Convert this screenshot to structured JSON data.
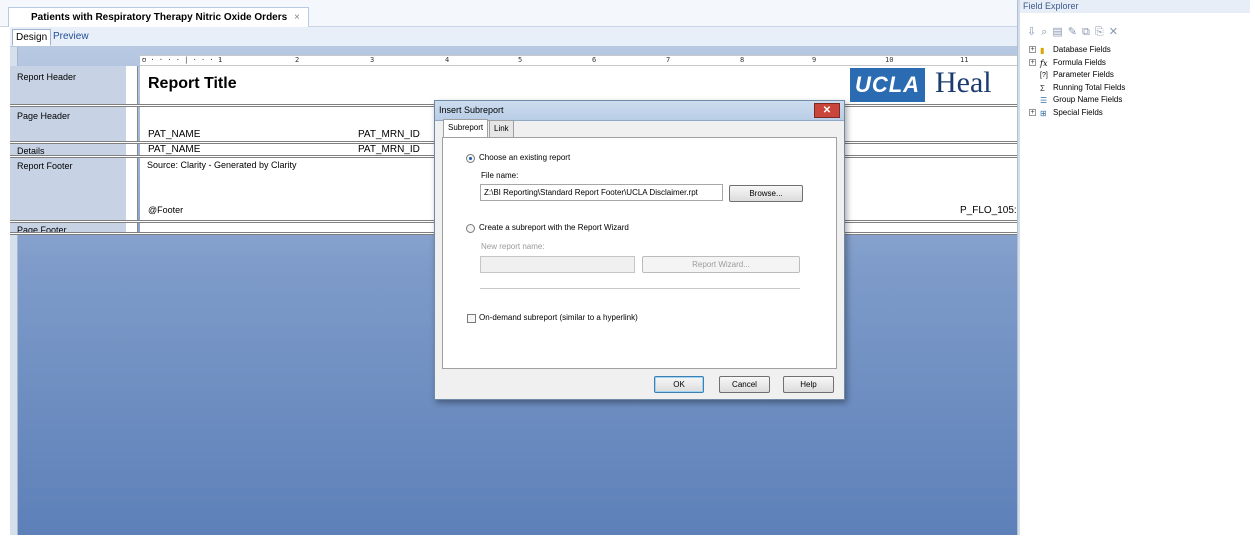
{
  "document_tab": {
    "title": "Patients with Respiratory Therapy Nitric Oxide Orders",
    "close": "×"
  },
  "view_tabs": {
    "design": "Design",
    "preview": "Preview"
  },
  "ruler": {
    "marks": [
      "1",
      "2",
      "3",
      "4",
      "5",
      "6",
      "7",
      "8",
      "9",
      "10",
      "11"
    ]
  },
  "sections": {
    "report_header": "Report Header",
    "page_header": "Page Header",
    "details": "Details",
    "report_footer": "Report Footer",
    "page_footer": "Page Footer"
  },
  "report": {
    "title": "Report Title",
    "logo_mark": "UCLA",
    "logo_text": "Heal",
    "page_header_fields": [
      "PAT_NAME",
      "PAT_MRN_ID"
    ],
    "detail_fields": [
      "PAT_NAME",
      "PAT_MRN_ID"
    ],
    "footer_source": "Source: Clarity - Generated by Clarity",
    "footer_formula": "@Footer",
    "footer_field": "P_FLO_105:"
  },
  "dialog": {
    "title": "Insert Subreport",
    "close": "✕",
    "tabs": [
      "Subreport",
      "Link"
    ],
    "choose_existing": "Choose an existing report",
    "file_name_label": "File name:",
    "file_name_value": "Z:\\BI Reporting\\Standard Report Footer\\UCLA Disclaimer.rpt",
    "browse": "Browse...",
    "create_wizard": "Create a subreport with the Report Wizard",
    "new_report_label": "New report name:",
    "report_wizard": "Report Wizard...",
    "on_demand": "On-demand subreport (similar to a hyperlink)",
    "ok": "OK",
    "cancel": "Cancel",
    "help": "Help"
  },
  "field_explorer": {
    "title": "Field Explorer",
    "items": [
      {
        "label": "Database Fields",
        "icon": "database-icon"
      },
      {
        "label": "Formula Fields",
        "icon": "formula-icon"
      },
      {
        "label": "Parameter Fields",
        "icon": "parameter-icon"
      },
      {
        "label": "Running Total Fields",
        "icon": "running-total-icon"
      },
      {
        "label": "Group Name Fields",
        "icon": "group-icon"
      },
      {
        "label": "Special Fields",
        "icon": "special-icon"
      }
    ]
  }
}
